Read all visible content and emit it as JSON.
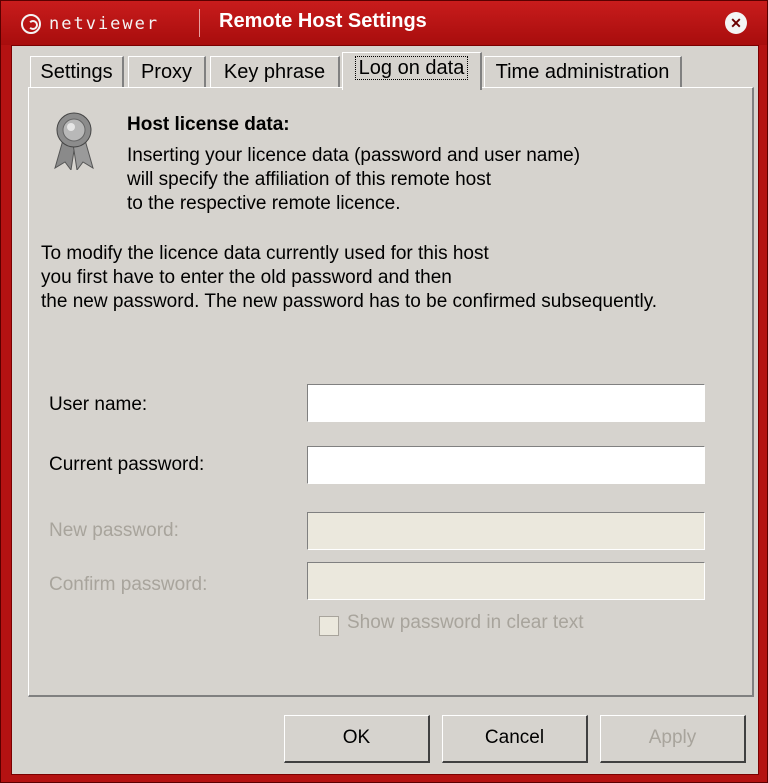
{
  "titlebar": {
    "logo_text": "netviewer",
    "title": "Remote Host Settings",
    "close_glyph": "✕"
  },
  "tabs": [
    {
      "label": "Settings"
    },
    {
      "label": "Proxy"
    },
    {
      "label": "Key phrase"
    },
    {
      "label": "Log on data",
      "active": true
    },
    {
      "label": "Time administration"
    }
  ],
  "panel": {
    "icon": "award-ribbon-icon",
    "heading": "Host license data:",
    "intro": "Inserting your licence data (password and user name)\nwill specify the affiliation of this remote host\nto the respective remote licence.",
    "note": "To modify the licence data currently used for this host\nyou first have to enter the old password and then\nthe new password. The new password has to be confirmed subsequently.",
    "fields": {
      "user_name": {
        "label": "User name:",
        "value": ""
      },
      "current_password": {
        "label": "Current password:",
        "value": ""
      },
      "new_password": {
        "label": "New password:",
        "value": "",
        "disabled": true
      },
      "confirm_password": {
        "label": "Confirm password:",
        "value": "",
        "disabled": true
      }
    },
    "show_password": {
      "label": "Show password in clear text",
      "checked": false,
      "disabled": true
    }
  },
  "buttons": {
    "ok": "OK",
    "cancel": "Cancel",
    "apply": "Apply"
  },
  "colors": {
    "frame": "#b41212",
    "face": "#d6d3ce",
    "disabled_text": "#a8a49c"
  }
}
